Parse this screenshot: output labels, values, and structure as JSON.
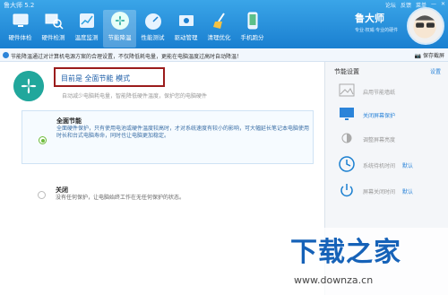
{
  "window": {
    "title": "鲁大师 5.2",
    "controls": [
      "论坛",
      "反馈",
      "菜单",
      "—",
      "✕"
    ]
  },
  "nav": [
    {
      "label": "硬件体检",
      "icon": "hardware-check-icon"
    },
    {
      "label": "硬件检测",
      "icon": "hardware-detect-icon"
    },
    {
      "label": "温度监测",
      "icon": "temperature-icon"
    },
    {
      "label": "节能降温",
      "icon": "fan-icon",
      "active": true
    },
    {
      "label": "性能测试",
      "icon": "speedometer-icon"
    },
    {
      "label": "驱动管理",
      "icon": "driver-icon"
    },
    {
      "label": "清理优化",
      "icon": "broom-icon"
    },
    {
      "label": "手机跑分",
      "icon": "phone-icon"
    }
  ],
  "brand": {
    "name": "鲁大师",
    "slogan": "专业·权威·专业的硬件"
  },
  "notice": {
    "text": "节能降温通过对计算机电源方案的合理设置，不仅降低耗电量，更能在电脑温度过高时自动降温！",
    "save_label": "保存截屏"
  },
  "main": {
    "current_mode": "目前是 全面节能 模式",
    "current_sub": "自动减少电脑耗电量，智能降低硬件温度，保护您的电脑硬件",
    "options": [
      {
        "title": "全面节能",
        "desc": "全面硬件保护，只有使用电池或硬件温度较高时，才对系统速度有较小的影响，可大幅延长笔记本电脑使用时长和台式电脑寿命，同时也让电脑更加稳定。",
        "selected": true
      },
      {
        "title": "关闭",
        "desc": "没有任何保护，让电脑始终工作在无任何保护的状态。",
        "selected": false
      }
    ]
  },
  "side": {
    "title": "节能设置",
    "link": "设置",
    "items": [
      {
        "label": "启用节能墙纸",
        "value": "",
        "icon": "wallpaper-icon",
        "on": false
      },
      {
        "label": "关闭屏幕保护",
        "value": "",
        "icon": "monitor-icon",
        "on": true
      },
      {
        "label": "调整屏幕亮度",
        "value": "",
        "icon": "brightness-icon",
        "on": false
      },
      {
        "label": "系统待机时间",
        "value": "默认",
        "icon": "clock-icon",
        "on": false
      },
      {
        "label": "屏幕关闭时间",
        "value": "默认",
        "icon": "power-icon",
        "on": false
      }
    ]
  },
  "watermark": {
    "big": "下载之家",
    "url": "www.downza.cn"
  },
  "colors": {
    "topbar": "#1a7fd0",
    "accent": "#2b84d9",
    "highlight_border": "#9b1c1c",
    "fan": "#21a79c"
  }
}
